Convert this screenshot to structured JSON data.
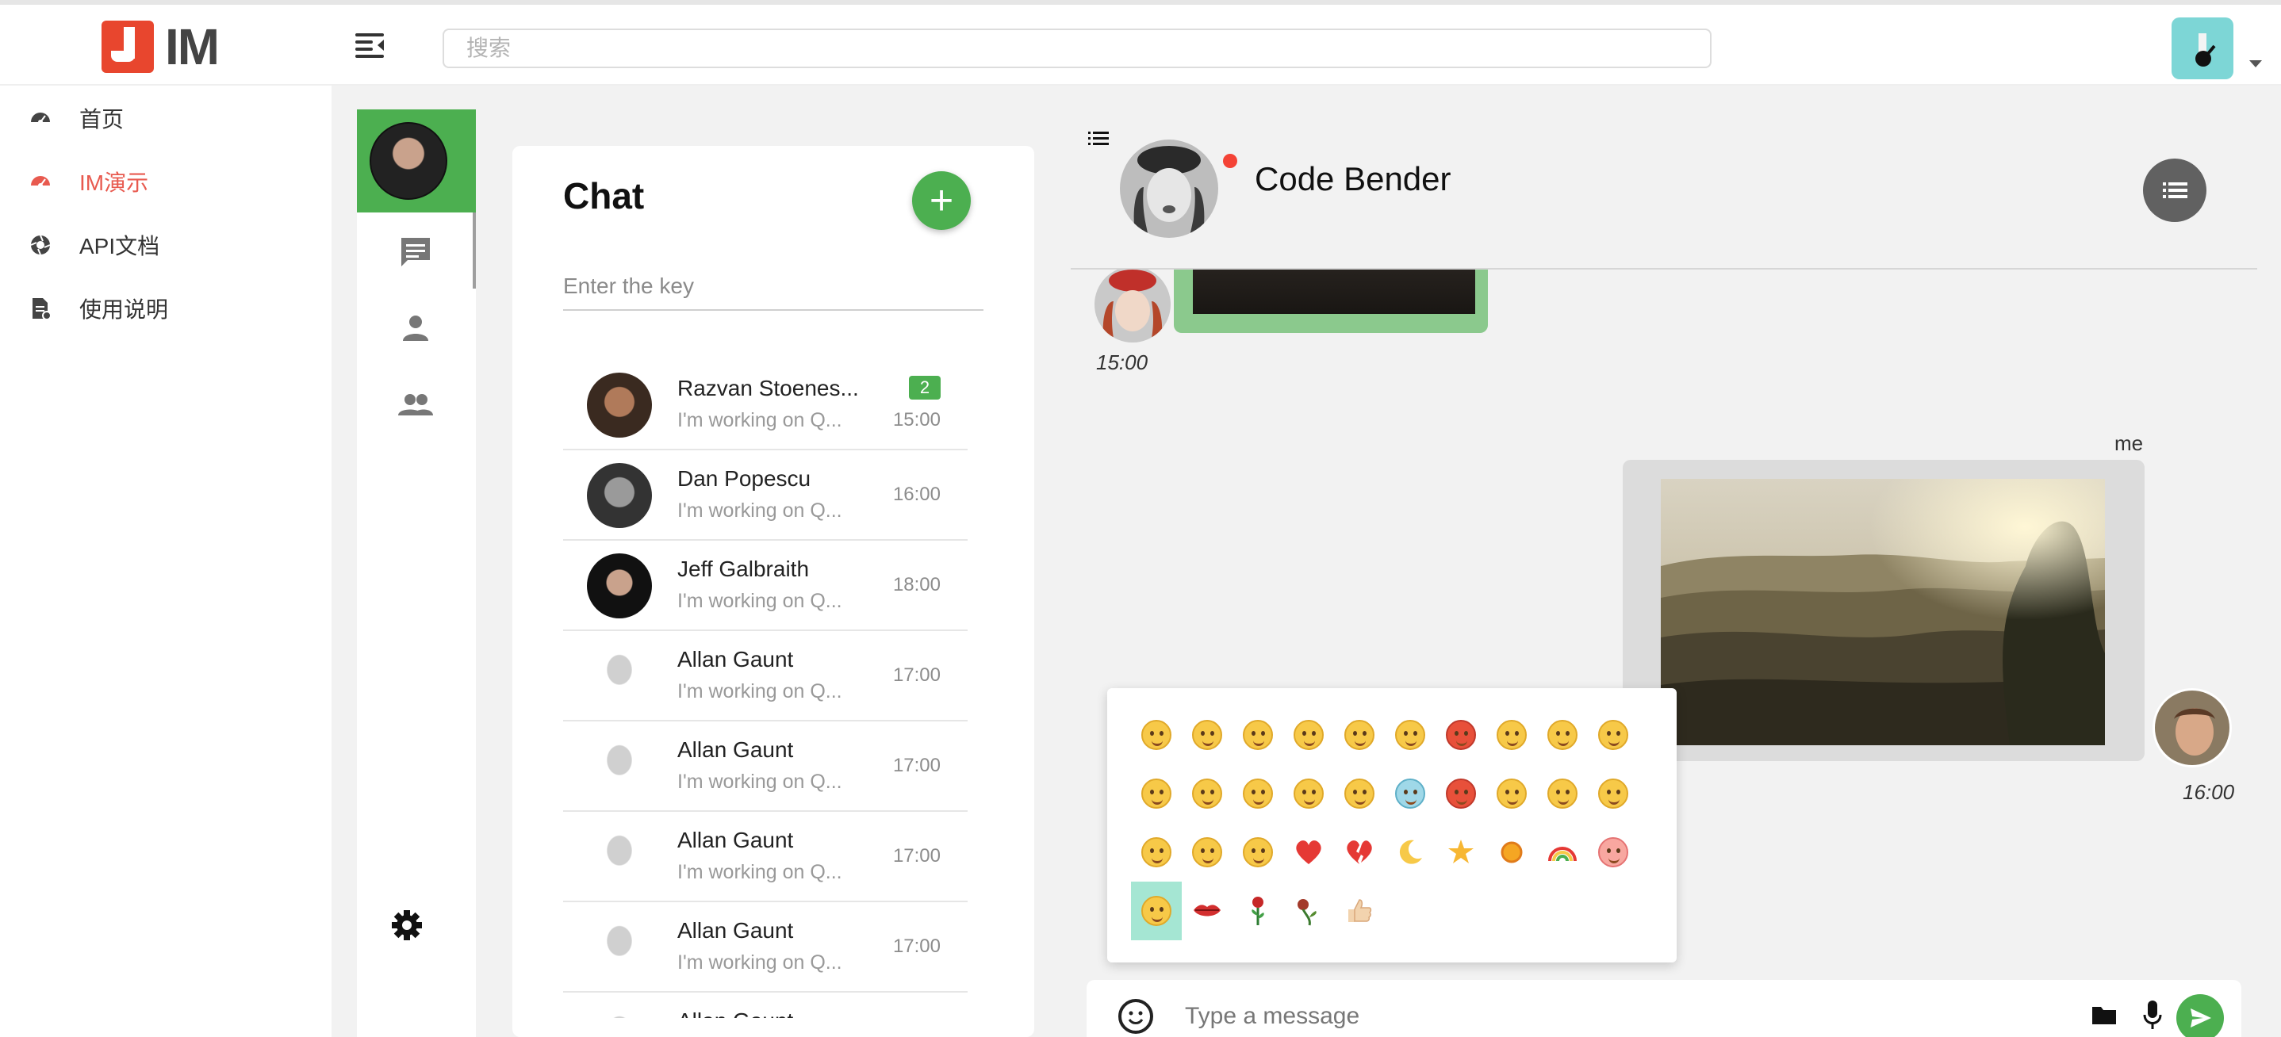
{
  "app": {
    "logo_text": "IM"
  },
  "header": {
    "search_placeholder": "搜索"
  },
  "site_nav": {
    "items": [
      {
        "label": "首页",
        "icon": "dashboard-icon"
      },
      {
        "label": "IM演示",
        "icon": "dashboard-icon",
        "active": true
      },
      {
        "label": "API文档",
        "icon": "aperture-icon"
      },
      {
        "label": "使用说明",
        "icon": "document-icon"
      }
    ]
  },
  "chat_panel": {
    "title": "Chat",
    "add_label": "+",
    "key_placeholder": "Enter the key",
    "rows": [
      {
        "name": "Razvan Stoenes...",
        "preview": "I'm working on Q...",
        "time": "15:00",
        "badge": "2"
      },
      {
        "name": "Dan Popescu",
        "preview": "I'm working on Q...",
        "time": "16:00"
      },
      {
        "name": "Jeff Galbraith",
        "preview": "I'm working on Q...",
        "time": "18:00"
      },
      {
        "name": "Allan Gaunt",
        "preview": "I'm working on Q...",
        "time": "17:00"
      },
      {
        "name": "Allan Gaunt",
        "preview": "I'm working on Q...",
        "time": "17:00"
      },
      {
        "name": "Allan Gaunt",
        "preview": "I'm working on Q...",
        "time": "17:00"
      },
      {
        "name": "Allan Gaunt",
        "preview": "I'm working on Q...",
        "time": "17:00"
      },
      {
        "name": "Allan Gaunt",
        "preview": "",
        "time": ""
      }
    ]
  },
  "conversation": {
    "name": "Code Bender",
    "incoming_time": "15:00",
    "me_label": "me",
    "outgoing_time": "16:00"
  },
  "composer": {
    "placeholder": "Type a message"
  },
  "colors": {
    "accent_green": "#4caf50",
    "nav_active": "#e85a4f",
    "logo_red": "#e8462e",
    "online_red": "#f44336"
  }
}
